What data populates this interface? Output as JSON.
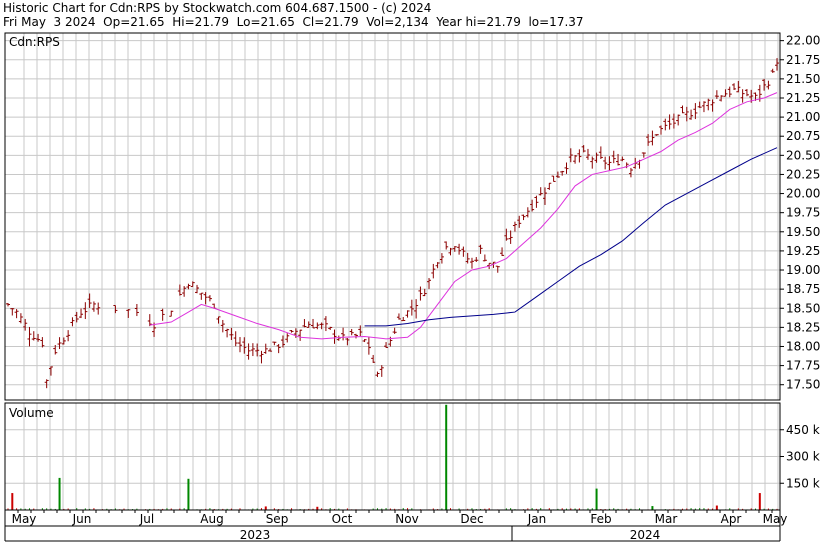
{
  "header": {
    "line1": "Historic Chart for Cdn:RPS by Stockwatch.com 604.687.1500 - (c) 2024",
    "line2": "Fri May  3 2024  Op=21.65  Hi=21.79  Lo=21.65  Cl=21.79  Vol=2,134  Year hi=21.79  lo=17.37"
  },
  "chart_data": [
    {
      "type": "ohlc",
      "title": "Cdn:RPS",
      "ylim": [
        17.3,
        22.1
      ],
      "y_ticks": [
        "22.00",
        "21.75",
        "21.50",
        "21.25",
        "21.00",
        "20.75",
        "20.50",
        "20.25",
        "20.00",
        "19.75",
        "19.50",
        "19.25",
        "19.00",
        "18.75",
        "18.50",
        "18.25",
        "18.00",
        "17.75",
        "17.50"
      ],
      "grid": true,
      "colors": {
        "bar": "#8b0000",
        "ma_short": "#dd33dd",
        "ma_long": "#00008b",
        "grid": "#c8c8c8"
      },
      "close_anchors": [
        [
          0,
          18.55
        ],
        [
          2,
          18.45
        ],
        [
          5,
          18.2
        ],
        [
          8,
          18.05
        ],
        [
          9,
          17.55
        ],
        [
          11,
          17.95
        ],
        [
          14,
          18.2
        ],
        [
          17,
          18.45
        ],
        [
          20,
          18.55
        ],
        [
          25,
          18.5
        ],
        [
          30,
          18.45
        ],
        [
          34,
          18.3
        ],
        [
          38,
          18.5
        ],
        [
          42,
          18.85
        ],
        [
          45,
          18.7
        ],
        [
          48,
          18.55
        ],
        [
          50,
          18.3
        ],
        [
          53,
          18.05
        ],
        [
          56,
          17.95
        ],
        [
          60,
          17.95
        ],
        [
          64,
          18.05
        ],
        [
          67,
          18.2
        ],
        [
          70,
          18.3
        ],
        [
          74,
          18.25
        ],
        [
          78,
          18.1
        ],
        [
          82,
          18.15
        ],
        [
          84,
          18.0
        ],
        [
          86,
          17.6
        ],
        [
          88,
          17.95
        ],
        [
          91,
          18.35
        ],
        [
          94,
          18.5
        ],
        [
          96,
          18.65
        ],
        [
          98,
          18.85
        ],
        [
          100,
          19.15
        ],
        [
          102,
          19.3
        ],
        [
          104,
          19.35
        ],
        [
          106,
          19.2
        ],
        [
          108,
          19.1
        ],
        [
          110,
          19.25
        ],
        [
          112,
          19.1
        ],
        [
          114,
          19.05
        ],
        [
          116,
          19.35
        ],
        [
          119,
          19.65
        ],
        [
          122,
          19.85
        ],
        [
          125,
          20.05
        ],
        [
          128,
          20.25
        ],
        [
          131,
          20.45
        ],
        [
          134,
          20.5
        ],
        [
          137,
          20.45
        ],
        [
          140,
          20.4
        ],
        [
          143,
          20.45
        ],
        [
          145,
          20.35
        ],
        [
          148,
          20.55
        ],
        [
          151,
          20.8
        ],
        [
          154,
          20.9
        ],
        [
          157,
          21.0
        ],
        [
          160,
          21.1
        ],
        [
          163,
          21.2
        ],
        [
          166,
          21.3
        ],
        [
          169,
          21.35
        ],
        [
          172,
          21.3
        ],
        [
          174,
          21.25
        ],
        [
          176,
          21.4
        ],
        [
          178,
          21.55
        ],
        [
          179,
          21.75
        ]
      ],
      "ma_short_anchors": [
        [
          33,
          18.28
        ],
        [
          38,
          18.32
        ],
        [
          42,
          18.45
        ],
        [
          45,
          18.55
        ],
        [
          48,
          18.5
        ],
        [
          53,
          18.4
        ],
        [
          58,
          18.3
        ],
        [
          63,
          18.22
        ],
        [
          68,
          18.12
        ],
        [
          73,
          18.1
        ],
        [
          78,
          18.12
        ],
        [
          83,
          18.13
        ],
        [
          88,
          18.1
        ],
        [
          93,
          18.12
        ],
        [
          96,
          18.25
        ],
        [
          100,
          18.55
        ],
        [
          104,
          18.85
        ],
        [
          108,
          19.0
        ],
        [
          112,
          19.05
        ],
        [
          116,
          19.15
        ],
        [
          120,
          19.35
        ],
        [
          124,
          19.55
        ],
        [
          128,
          19.8
        ],
        [
          132,
          20.1
        ],
        [
          136,
          20.25
        ],
        [
          140,
          20.3
        ],
        [
          144,
          20.35
        ],
        [
          148,
          20.45
        ],
        [
          152,
          20.55
        ],
        [
          156,
          20.7
        ],
        [
          160,
          20.8
        ],
        [
          164,
          20.92
        ],
        [
          168,
          21.1
        ],
        [
          172,
          21.2
        ],
        [
          176,
          21.25
        ],
        [
          179,
          21.32
        ]
      ],
      "ma_long_anchors": [
        [
          83,
          18.27
        ],
        [
          88,
          18.27
        ],
        [
          93,
          18.3
        ],
        [
          98,
          18.35
        ],
        [
          103,
          18.38
        ],
        [
          108,
          18.4
        ],
        [
          113,
          18.42
        ],
        [
          118,
          18.45
        ],
        [
          123,
          18.65
        ],
        [
          128,
          18.85
        ],
        [
          133,
          19.05
        ],
        [
          138,
          19.2
        ],
        [
          143,
          19.38
        ],
        [
          148,
          19.62
        ],
        [
          153,
          19.85
        ],
        [
          158,
          20.0
        ],
        [
          163,
          20.15
        ],
        [
          168,
          20.3
        ],
        [
          173,
          20.45
        ],
        [
          179,
          20.6
        ]
      ]
    },
    {
      "type": "bar",
      "title": "Volume",
      "ylim": [
        0,
        600000
      ],
      "y_ticks": [
        {
          "label": "450 k",
          "value": 450000
        },
        {
          "label": "300 k",
          "value": 300000
        },
        {
          "label": "150 k",
          "value": 150000
        }
      ],
      "colors": {
        "up": "#008800",
        "down": "#cc0000",
        "base": "#888888"
      },
      "spikes": [
        {
          "i": 1,
          "v": 95000,
          "c": "down"
        },
        {
          "i": 12,
          "v": 180000,
          "c": "up"
        },
        {
          "i": 42,
          "v": 175000,
          "c": "up"
        },
        {
          "i": 102,
          "v": 590000,
          "c": "up"
        },
        {
          "i": 137,
          "v": 120000,
          "c": "up"
        },
        {
          "i": 175,
          "v": 95000,
          "c": "down"
        },
        {
          "i": 60,
          "v": 20000,
          "c": "down"
        },
        {
          "i": 72,
          "v": 18000,
          "c": "down"
        },
        {
          "i": 150,
          "v": 22000,
          "c": "up"
        },
        {
          "i": 165,
          "v": 25000,
          "c": "down"
        }
      ],
      "n_bars": 180
    }
  ],
  "x_axis": {
    "months": [
      "May",
      "Jun",
      "Jul",
      "Aug",
      "Sep",
      "Oct",
      "Nov",
      "Dec",
      "Jan",
      "Feb",
      "Mar",
      "Apr",
      "May"
    ],
    "years": [
      "2023",
      "2024"
    ]
  }
}
